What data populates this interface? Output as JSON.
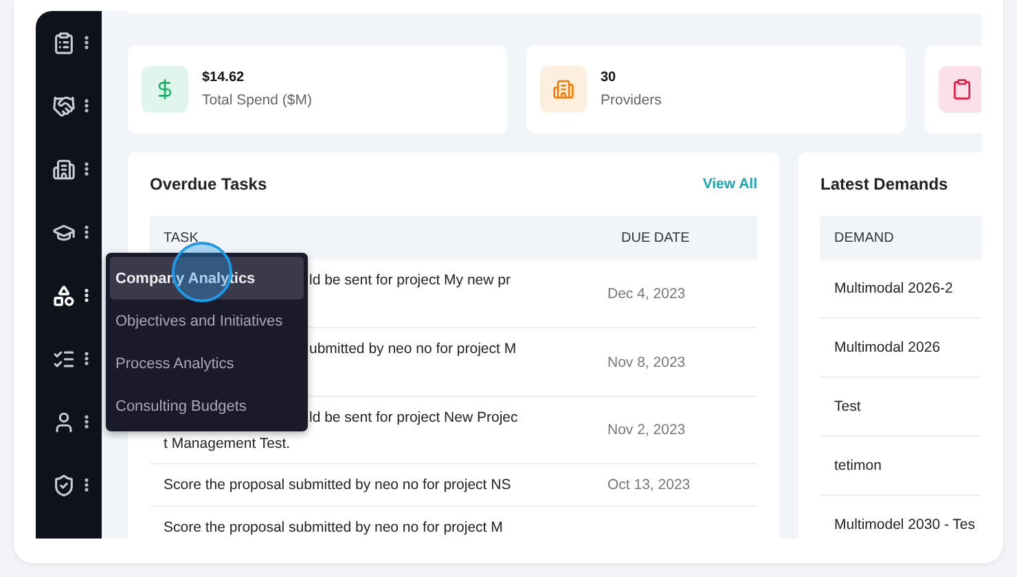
{
  "sidebar": {
    "items": [
      {
        "selected": false
      },
      {
        "selected": false
      },
      {
        "selected": false
      },
      {
        "selected": false
      },
      {
        "selected": true
      },
      {
        "selected": false
      },
      {
        "selected": false
      },
      {
        "selected": false
      }
    ]
  },
  "flyout_menu": {
    "items": [
      {
        "label": "Company Analytics",
        "selected": true
      },
      {
        "label": "Objectives and Initiatives",
        "selected": false
      },
      {
        "label": "Process Analytics",
        "selected": false
      },
      {
        "label": "Consulting Budgets",
        "selected": false
      }
    ]
  },
  "stats": [
    {
      "value": "$14.62",
      "label": "Total Spend ($M)",
      "color": "#17b26a"
    },
    {
      "value": "30",
      "label": "Providers",
      "color": "#f57c00"
    },
    {
      "color": "#e11d48"
    }
  ],
  "overdue_tasks": {
    "title": "Overdue Tasks",
    "link": "View All",
    "columns": [
      "TASK",
      "DUE DATE"
    ],
    "rows": [
      {
        "kind": "covered",
        "lines": [
          "ld be sent for project My new pr"
        ],
        "due": "Dec 4, 2023"
      },
      {
        "kind": "covered",
        "lines": [
          "ubmitted by neo no for project M"
        ],
        "due": "Nov 8, 2023"
      },
      {
        "kind": "covered",
        "lines": [
          "ld be sent for project New Projec",
          "t Management Test."
        ],
        "due": "Nov 2, 2023"
      },
      {
        "kind": "full",
        "lines": [
          "Score the proposal submitted by neo no for project NS"
        ],
        "due": "Oct 13, 2023"
      },
      {
        "kind": "full",
        "lines": [
          "Score the proposal submitted by neo no for project M"
        ]
      }
    ]
  },
  "latest_demands": {
    "title": "Latest Demands",
    "columns": [
      "DEMAND"
    ],
    "rows": [
      "Multimodal 2026-2",
      "Multimodal 2026",
      "Test",
      "tetimon",
      "Multimodel 2030 - Tes"
    ]
  }
}
